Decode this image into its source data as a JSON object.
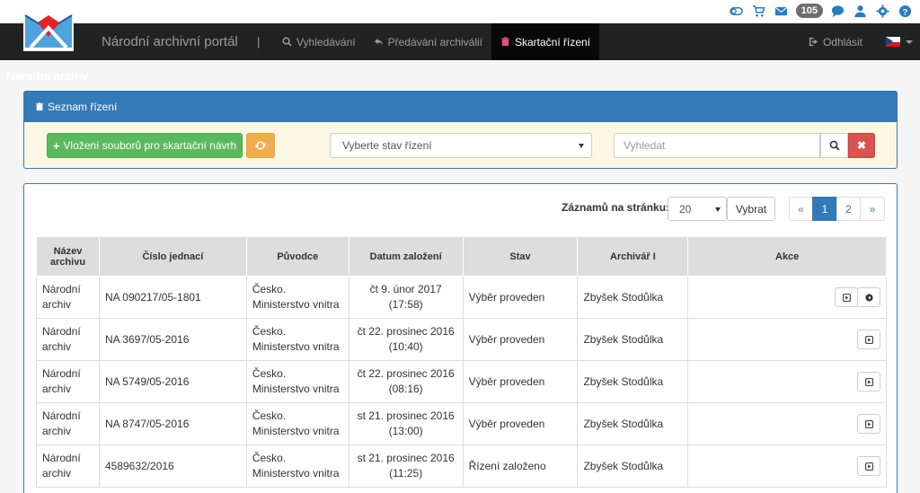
{
  "topbar": {
    "badge_count": "105"
  },
  "header": {
    "logo_text": "Národní archiv",
    "brand": "Národní archivní portál",
    "separator": "|",
    "nav": [
      {
        "label": "Vyhledávání"
      },
      {
        "label": "Předávání archiválií"
      },
      {
        "label": "Skartační řízení"
      }
    ],
    "logout": "Odhlásit"
  },
  "filter_panel": {
    "title": "Seznam řízení",
    "add_button": "Vložení souborů pro skartační návrh",
    "state_select": "Vyberte stav řízení",
    "search_placeholder": "Vyhledat",
    "clear_label": "✖"
  },
  "list_panel": {
    "per_page_label": "Záznamů na stránku:",
    "per_page_value": "20",
    "select_button": "Vybrat",
    "pagination": {
      "prev": "«",
      "pages": [
        "1",
        "2"
      ],
      "next": "»",
      "current": "1"
    },
    "columns": [
      "Název archivu",
      "Číslo jednací",
      "Původce",
      "Datum založení",
      "Stav",
      "Archivář I",
      "Akce"
    ],
    "rows": [
      {
        "archive": "Národní archiv",
        "ref": "NA 090217/05-1801",
        "origin": "Česko. Ministerstvo vnitra",
        "date": "čt 9. únor 2017",
        "time": "(17:58)",
        "state": "Výběr proveden",
        "archivist": "Zbyšek Stodůlka"
      },
      {
        "archive": "Národní archiv",
        "ref": "NA 3697/05-2016",
        "origin": "Česko. Ministerstvo vnitra",
        "date": "čt 22. prosinec 2016",
        "time": "(10:40)",
        "state": "Výběr proveden",
        "archivist": "Zbyšek Stodůlka"
      },
      {
        "archive": "Národní archiv",
        "ref": "NA 5749/05-2016",
        "origin": "Česko. Ministerstvo vnitra",
        "date": "čt 22. prosinec 2016",
        "time": "(08:16)",
        "state": "Výběr proveden",
        "archivist": "Zbyšek Stodůlka"
      },
      {
        "archive": "Národní archiv",
        "ref": "NA 8747/05-2016",
        "origin": "Česko. Ministerstvo vnitra",
        "date": "st 21. prosinec 2016",
        "time": "(13:00)",
        "state": "Výběr proveden",
        "archivist": "Zbyšek Stodůlka"
      },
      {
        "archive": "Národní archiv",
        "ref": "4589632/2016",
        "origin": "Česko. Ministerstvo vnitra",
        "date": "st 21. prosinec 2016",
        "time": "(11:25)",
        "state": "Řízení založeno",
        "archivist": "Zbyšek Stodůlka"
      }
    ]
  },
  "colors": {
    "primary": "#337ab7",
    "success": "#5cb85c",
    "warning": "#f0ad4e",
    "danger": "#d9534f",
    "navbar": "#222222"
  },
  "icons": [
    "toggle-icon",
    "cart-icon",
    "envelope-icon",
    "chat-icon",
    "user-icon",
    "gear-icon",
    "help-icon",
    "search-icon",
    "reply-icon",
    "trash-icon",
    "logout-icon",
    "refresh-icon",
    "play-icon",
    "back-icon"
  ]
}
